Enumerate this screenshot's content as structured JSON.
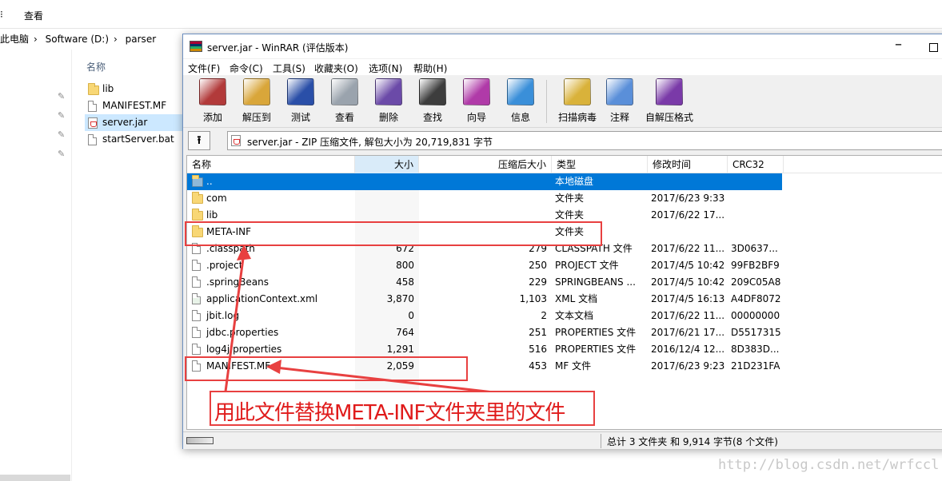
{
  "explorer": {
    "ribbon_tabs": [
      "查看"
    ],
    "breadcrumb": [
      "此电脑",
      "Software (D:)",
      "parser"
    ],
    "column_name": "名称",
    "files": [
      {
        "name": "lib",
        "icon": "folder-icon"
      },
      {
        "name": "MANIFEST.MF",
        "icon": "file-icon"
      },
      {
        "name": "server.jar",
        "icon": "jar-icon",
        "selected": true
      },
      {
        "name": "startServer.bat",
        "icon": "bat-file-icon"
      }
    ]
  },
  "winrar": {
    "title": "server.jar - WinRAR (评估版本)",
    "menu": [
      "文件(F)",
      "命令(C)",
      "工具(S)",
      "收藏夹(O)",
      "选项(N)",
      "帮助(H)"
    ],
    "toolbar": [
      {
        "label": "添加",
        "icon": "add-archive-icon",
        "color": "#b23a3a"
      },
      {
        "label": "解压到",
        "icon": "extract-to-icon",
        "color": "#d9a63a"
      },
      {
        "label": "测试",
        "icon": "test-icon",
        "color": "#2a4fa8"
      },
      {
        "label": "查看",
        "icon": "view-icon",
        "color": "#9aa3ad"
      },
      {
        "label": "删除",
        "icon": "delete-icon",
        "color": "#6b4aa8"
      },
      {
        "label": "查找",
        "icon": "find-icon",
        "color": "#3d3d3d"
      },
      {
        "label": "向导",
        "icon": "wizard-icon",
        "color": "#b03aa8"
      },
      {
        "label": "信息",
        "icon": "info-icon",
        "color": "#3a8fd9"
      },
      {
        "label": "扫描病毒",
        "icon": "scan-virus-icon",
        "color": "#d9b23a"
      },
      {
        "label": "注释",
        "icon": "comment-icon",
        "color": "#5a8fd9"
      },
      {
        "label": "自解压格式",
        "icon": "sfx-icon",
        "color": "#7a3aa8"
      }
    ],
    "path_text": "server.jar - ZIP 压缩文件, 解包大小为 20,719,831 字节",
    "columns": {
      "name": "名称",
      "size": "大小",
      "packed": "压缩后大小",
      "type": "类型",
      "modified": "修改时间",
      "crc": "CRC32"
    },
    "rows": [
      {
        "name": "..",
        "size": "",
        "packed": "",
        "type": "本地磁盘",
        "modified": "",
        "crc": "",
        "icon": "drive-icon",
        "selected": true
      },
      {
        "name": "com",
        "size": "",
        "packed": "",
        "type": "文件夹",
        "modified": "2017/6/23 9:33",
        "crc": "",
        "icon": "folder-icon"
      },
      {
        "name": "lib",
        "size": "",
        "packed": "",
        "type": "文件夹",
        "modified": "2017/6/22 17...",
        "crc": "",
        "icon": "folder-icon"
      },
      {
        "name": "META-INF",
        "size": "",
        "packed": "",
        "type": "文件夹",
        "modified": "",
        "crc": "",
        "icon": "folder-icon"
      },
      {
        "name": ".classpath",
        "size": "672",
        "packed": "279",
        "type": "CLASSPATH 文件",
        "modified": "2017/6/22 11...",
        "crc": "3D0637...",
        "icon": "file-icon"
      },
      {
        "name": ".project",
        "size": "800",
        "packed": "250",
        "type": "PROJECT 文件",
        "modified": "2017/4/5 10:42",
        "crc": "99FB2BF9",
        "icon": "file-icon"
      },
      {
        "name": ".springBeans",
        "size": "458",
        "packed": "229",
        "type": "SPRINGBEANS ...",
        "modified": "2017/4/5 10:42",
        "crc": "209C05A8",
        "icon": "file-icon"
      },
      {
        "name": "applicationContext.xml",
        "size": "3,870",
        "packed": "1,103",
        "type": "XML 文档",
        "modified": "2017/4/5 16:13",
        "crc": "A4DF8072",
        "icon": "xml-file-icon"
      },
      {
        "name": "jbit.log",
        "size": "0",
        "packed": "2",
        "type": "文本文档",
        "modified": "2017/6/22 11...",
        "crc": "00000000",
        "icon": "file-icon"
      },
      {
        "name": "jdbc.properties",
        "size": "764",
        "packed": "251",
        "type": "PROPERTIES 文件",
        "modified": "2017/6/21 17...",
        "crc": "D5517315",
        "icon": "file-icon"
      },
      {
        "name": "log4j.properties",
        "size": "1,291",
        "packed": "516",
        "type": "PROPERTIES 文件",
        "modified": "2016/12/4 12...",
        "crc": "8D383D...",
        "icon": "file-icon"
      },
      {
        "name": "MANIFEST.MF",
        "size": "2,059",
        "packed": "453",
        "type": "MF 文件",
        "modified": "2017/6/23 9:23",
        "crc": "21D231FA",
        "icon": "file-icon"
      }
    ],
    "status_text": "总计 3 文件夹 和 9,914 字节(8 个文件)"
  },
  "annotation": {
    "caption": "用此文件替换META-INF文件夹里的文件",
    "color": "#e84040"
  },
  "watermark": "http://blog.csdn.net/wrfccl"
}
